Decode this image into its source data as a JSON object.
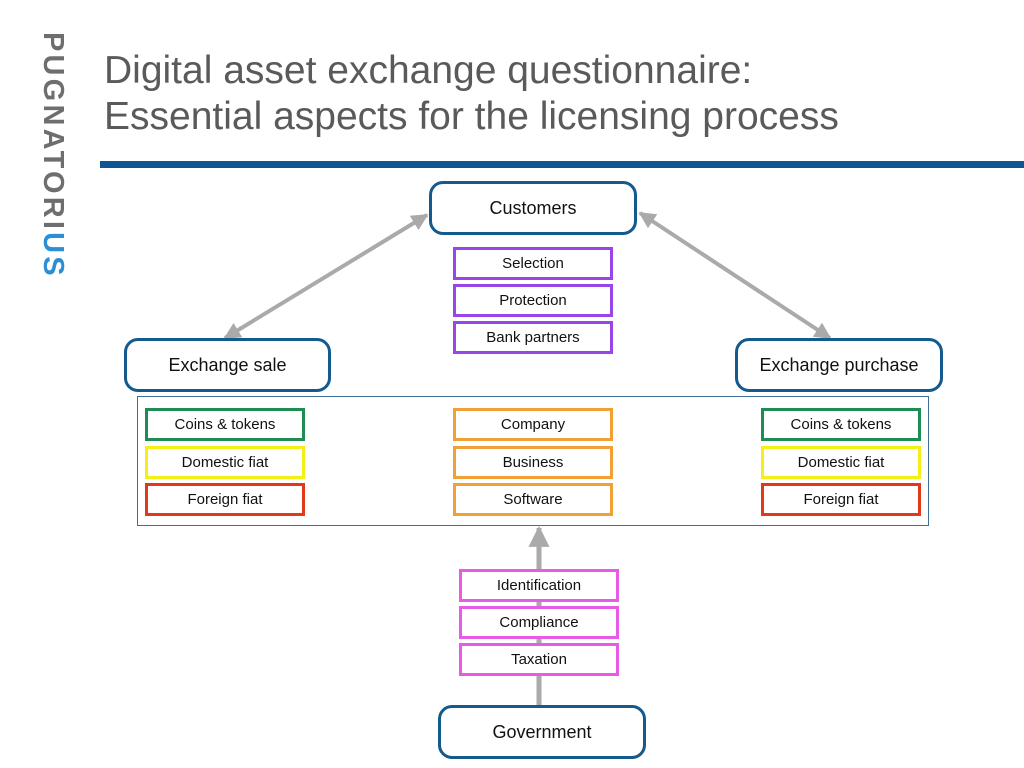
{
  "logo": {
    "text_main": "PUGNATORI",
    "text_accent": "US"
  },
  "title": {
    "line1": "Digital asset exchange questionnaire:",
    "line2": "Essential aspects for the licensing process"
  },
  "colors": {
    "brand_blue": "#0e5595",
    "node_border": "#145a8d",
    "arrow_gray": "#aaaaaa",
    "customers_group": "#9a45e8",
    "coins_tokens": "#1f8c54",
    "domestic_fiat": "#f5ef16",
    "foreign_fiat": "#e2391b",
    "exchange_group": "#f0a035",
    "government_group": "#e85be8"
  },
  "nodes": {
    "customers": "Customers",
    "exchange_sale": "Exchange sale",
    "exchange_purchase": "Exchange purchase",
    "government": "Government"
  },
  "customers_items": [
    "Selection",
    "Protection",
    "Bank partners"
  ],
  "sale_items": [
    "Coins & tokens",
    "Domestic fiat",
    "Foreign fiat"
  ],
  "exchange_items": [
    "Company",
    "Business",
    "Software"
  ],
  "purchase_items": [
    "Coins & tokens",
    "Domestic fiat",
    "Foreign fiat"
  ],
  "government_items": [
    "Identification",
    "Compliance",
    "Taxation"
  ],
  "connections": [
    {
      "from": "customers",
      "to": "exchange_sale",
      "direction": "both"
    },
    {
      "from": "customers",
      "to": "exchange_purchase",
      "direction": "both"
    },
    {
      "from": "government",
      "to": "exchange",
      "direction": "forward"
    }
  ]
}
